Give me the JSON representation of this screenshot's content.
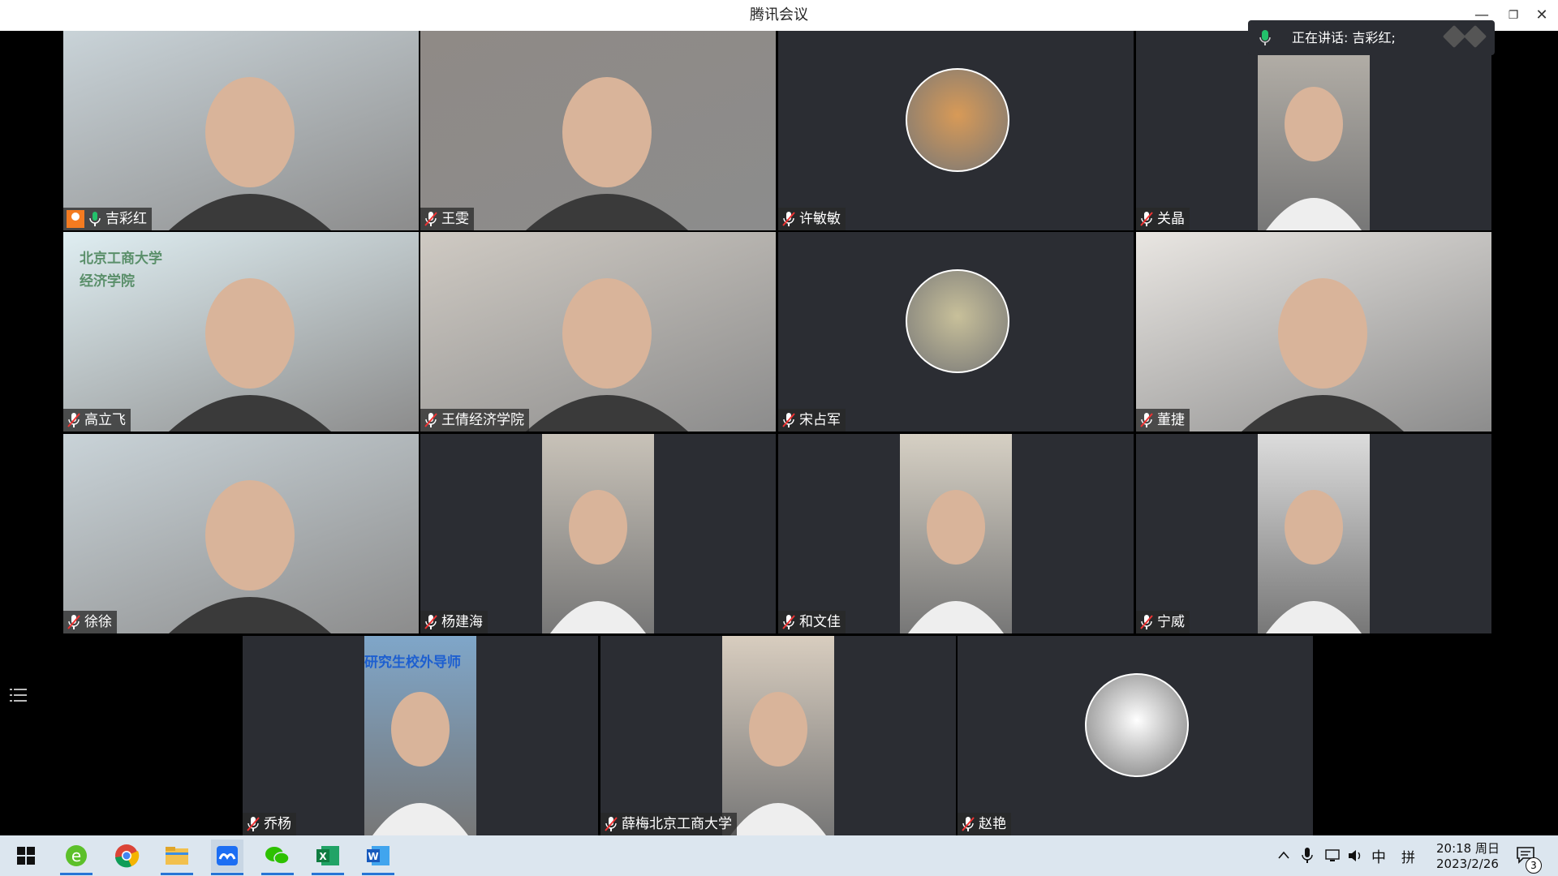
{
  "window": {
    "title": "腾讯会议",
    "min": "—",
    "max": "❐",
    "close": "✕"
  },
  "speaking": {
    "text": "正在讲话: 吉彩红;"
  },
  "participants": [
    {
      "name": "吉彩红",
      "host": true,
      "speaking": true,
      "bg": "#c9d3d8",
      "kind": "full"
    },
    {
      "name": "王雯",
      "bg": "#8f8a86",
      "kind": "full"
    },
    {
      "name": "许敏敏",
      "bg": "#2b2d33",
      "kind": "avatar",
      "avatar_color": "#d89a57"
    },
    {
      "name": "关晶",
      "bg": "#2b2d33",
      "kind": "portrait",
      "portrait_color": "#b9b4ac"
    },
    {
      "name": "高立飞",
      "bg": "#dfeef2",
      "kind": "full",
      "overlay_line1": "北京工商大学",
      "overlay_line2": "经济学院"
    },
    {
      "name": "王倩经济学院",
      "bg": "#cfcac3",
      "kind": "full"
    },
    {
      "name": "宋占军",
      "bg": "#2b2d33",
      "kind": "avatar",
      "avatar_color": "#c8c09a"
    },
    {
      "name": "董捷",
      "bg": "#e9e6e2",
      "kind": "full"
    },
    {
      "name": "徐徐",
      "bg": "#c9d3d8",
      "kind": "full"
    },
    {
      "name": "杨建海",
      "bg": "#2b2d33",
      "kind": "portrait",
      "portrait_color": "#c8c2b8"
    },
    {
      "name": "和文佳",
      "bg": "#2b2d33",
      "kind": "portrait",
      "portrait_color": "#d6d0c4"
    },
    {
      "name": "宁威",
      "bg": "#2b2d33",
      "kind": "portrait",
      "portrait_color": "#dcdcdc"
    },
    {
      "name": "乔杨",
      "bg": "#2b2d33",
      "kind": "portrait",
      "portrait_color": "#7fa6c9",
      "overlay_line1": "研究生校外导师"
    },
    {
      "name": "薛梅北京工商大学",
      "bg": "#2b2d33",
      "kind": "portrait",
      "portrait_color": "#d8cdbf"
    },
    {
      "name": "赵艳",
      "bg": "#2b2d33",
      "kind": "avatar",
      "avatar_color": "#ffffff"
    }
  ],
  "taskbar": {
    "apps": [
      "start-icon",
      "ie-icon",
      "chrome-icon",
      "file-explorer-icon",
      "tencent-meeting-icon",
      "wechat-icon",
      "excel-icon",
      "word-icon"
    ],
    "ime_lang": "中",
    "ime_mode": "拼",
    "time": "20:18 周日",
    "date": "2023/2/26",
    "notifications": "3"
  }
}
